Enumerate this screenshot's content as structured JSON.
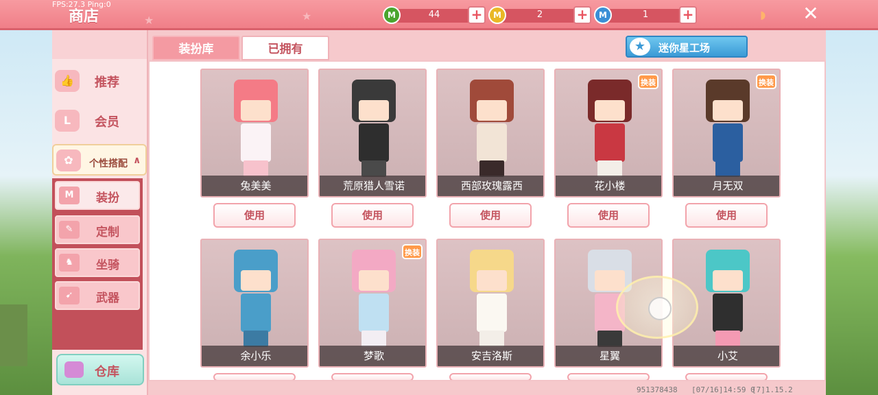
{
  "debug": {
    "fps": "FPS:27.3  Ping:0"
  },
  "header": {
    "title": "商店",
    "currencies": [
      {
        "icon": "green-mini-coin-icon",
        "value": "44",
        "color": "#4aa52e"
      },
      {
        "icon": "gold-mini-coin-icon",
        "value": "2",
        "color": "#e9b826"
      },
      {
        "icon": "blue-mini-coin-icon",
        "value": "1",
        "color": "#3a8fd6"
      }
    ],
    "coin_letter": "M",
    "plus": "+",
    "close": "✕"
  },
  "sidebar": {
    "items": [
      {
        "label": "推荐",
        "icon": "thumbs-up-icon"
      },
      {
        "label": "会员",
        "icon": "vip-icon"
      },
      {
        "label": "个性搭配",
        "icon": "personal-style-icon",
        "arrow": "∧"
      }
    ],
    "sub_items": [
      {
        "label": "装扮",
        "icon": "outfit-icon",
        "glyph": "M"
      },
      {
        "label": "定制",
        "icon": "customize-icon",
        "glyph": "✎"
      },
      {
        "label": "坐骑",
        "icon": "mount-icon",
        "glyph": "♞"
      },
      {
        "label": "武器",
        "icon": "weapon-icon",
        "glyph": "➹"
      }
    ],
    "warehouse": "仓库"
  },
  "tabs": {
    "library": "装扮库",
    "owned": "已拥有"
  },
  "workshop": {
    "label": "迷你星工场",
    "star": "★"
  },
  "cards": [
    {
      "name": "兔美美",
      "use": "使用",
      "badge": "",
      "hair": "#f47b86",
      "body": "#fbf3f6",
      "legs": "#f7c2cc"
    },
    {
      "name": "荒原猎人雪诺",
      "use": "使用",
      "badge": "",
      "hair": "#3a3a3a",
      "body": "#2e2e2e",
      "legs": "#4a4a4a"
    },
    {
      "name": "西部玫瑰露西",
      "use": "使用",
      "badge": "",
      "hair": "#a04a3a",
      "body": "#f2e4d6",
      "legs": "#3a2a2a"
    },
    {
      "name": "花小楼",
      "use": "使用",
      "badge": "换装",
      "hair": "#7a2a2a",
      "body": "#c93842",
      "legs": "#f3eee8"
    },
    {
      "name": "月无双",
      "use": "使用",
      "badge": "换装",
      "hair": "#5a3a2a",
      "body": "#2b5fa0",
      "legs": "#2b5fa0"
    },
    {
      "name": "余小乐",
      "use": "使用",
      "badge": "",
      "hair": "#4a9ec9",
      "body": "#4a9ec9",
      "legs": "#3c7ba3"
    },
    {
      "name": "梦歌",
      "use": "使用",
      "badge": "换装",
      "hair": "#f3a9c4",
      "body": "#bfe0f2",
      "legs": "#f3eef3"
    },
    {
      "name": "安吉洛斯",
      "use": "使用",
      "badge": "",
      "hair": "#f6d88a",
      "body": "#fbf8f2",
      "legs": "#f3eee8"
    },
    {
      "name": "星翼",
      "use": "使用",
      "badge": "",
      "hair": "#d9dee6",
      "body": "#f4b5c8",
      "legs": "#3a3a3a"
    },
    {
      "name": "小艾",
      "use": "使用",
      "badge": "",
      "hair": "#4cc7c7",
      "body": "#2f2f2f",
      "legs": "#f49ab3"
    }
  ],
  "footer": {
    "uid": "951378438",
    "time": "[07/16]14:59 0",
    "version": "[7]1.15.2"
  }
}
